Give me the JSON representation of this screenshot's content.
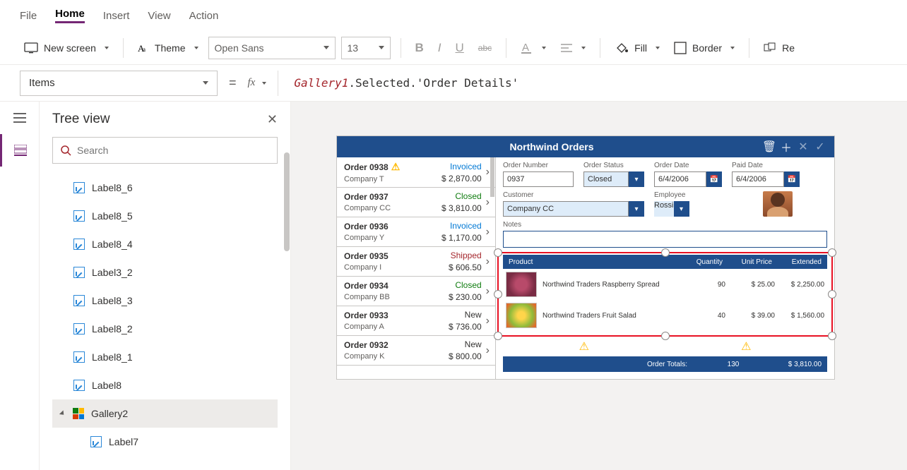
{
  "menu": {
    "file": "File",
    "home": "Home",
    "insert": "Insert",
    "view": "View",
    "action": "Action"
  },
  "toolbar": {
    "newScreen": "New screen",
    "theme": "Theme",
    "font": "Open Sans",
    "fontSize": "13",
    "fill": "Fill",
    "border": "Border",
    "reorder": "Re"
  },
  "property": {
    "name": "Items"
  },
  "formula": {
    "obj": "Gallery1",
    "rest": ".Selected.'Order Details'"
  },
  "tree": {
    "title": "Tree view",
    "searchPlaceholder": "Search",
    "items": [
      {
        "label": "Label8_6"
      },
      {
        "label": "Label8_5"
      },
      {
        "label": "Label8_4"
      },
      {
        "label": "Label3_2"
      },
      {
        "label": "Label8_3"
      },
      {
        "label": "Label8_2"
      },
      {
        "label": "Label8_1"
      },
      {
        "label": "Label8"
      }
    ],
    "selected": "Gallery2",
    "child": "Label7"
  },
  "app": {
    "title": "Northwind Orders",
    "orders": [
      {
        "name": "Order 0938",
        "company": "Company T",
        "status": "Invoiced",
        "statusClass": "st-inv",
        "amount": "$ 2,870.00",
        "warn": true
      },
      {
        "name": "Order 0937",
        "company": "Company CC",
        "status": "Closed",
        "statusClass": "st-closed",
        "amount": "$ 3,810.00"
      },
      {
        "name": "Order 0936",
        "company": "Company Y",
        "status": "Invoiced",
        "statusClass": "st-inv",
        "amount": "$ 1,170.00"
      },
      {
        "name": "Order 0935",
        "company": "Company I",
        "status": "Shipped",
        "statusClass": "st-ship",
        "amount": "$ 606.50"
      },
      {
        "name": "Order 0934",
        "company": "Company BB",
        "status": "Closed",
        "statusClass": "st-closed",
        "amount": "$ 230.00"
      },
      {
        "name": "Order 0933",
        "company": "Company A",
        "status": "New",
        "statusClass": "st-new",
        "amount": "$ 736.00"
      },
      {
        "name": "Order 0932",
        "company": "Company K",
        "status": "New",
        "statusClass": "st-new",
        "amount": "$ 800.00"
      }
    ],
    "detail": {
      "orderNumberLabel": "Order Number",
      "orderNumber": "0937",
      "orderStatusLabel": "Order Status",
      "orderStatus": "Closed",
      "orderDateLabel": "Order Date",
      "orderDate": "6/4/2006",
      "paidDateLabel": "Paid Date",
      "paidDate": "6/4/2006",
      "customerLabel": "Customer",
      "customer": "Company CC",
      "employeeLabel": "Employee",
      "employee": "Rossi",
      "notesLabel": "Notes"
    },
    "grid": {
      "headers": {
        "product": "Product",
        "qty": "Quantity",
        "price": "Unit Price",
        "ext": "Extended"
      },
      "rows": [
        {
          "name": "Northwind Traders Raspberry Spread",
          "qty": "90",
          "price": "$ 25.00",
          "ext": "$ 2,250.00"
        },
        {
          "name": "Northwind Traders Fruit Salad",
          "qty": "40",
          "price": "$ 39.00",
          "ext": "$ 1,560.00"
        }
      ]
    },
    "totals": {
      "label": "Order Totals:",
      "qty": "130",
      "amount": "$ 3,810.00"
    }
  }
}
